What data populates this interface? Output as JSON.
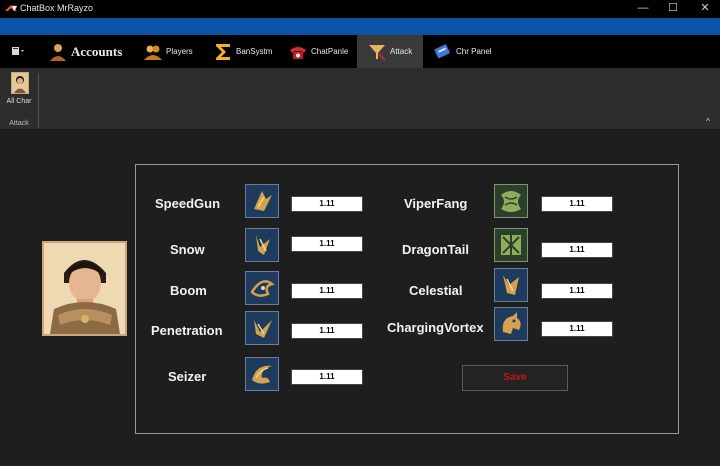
{
  "window": {
    "title": "ChatBox MrRayzo",
    "minimize": "—",
    "maximize": "☐",
    "close": "✕"
  },
  "quick_access": {
    "arrow": "▼"
  },
  "tabs": [
    {
      "label": "Accounts",
      "icon": "accounts-icon",
      "active": false
    },
    {
      "label": "Players",
      "icon": "players-icon",
      "active": false
    },
    {
      "label": "BanSystm",
      "icon": "sigma-icon",
      "active": false
    },
    {
      "label": "ChatPanle",
      "icon": "phone-icon",
      "active": false
    },
    {
      "label": "Attack",
      "icon": "attack-icon",
      "active": true
    },
    {
      "label": "Chr Panel",
      "icon": "chr-panel-icon",
      "active": false
    }
  ],
  "ribbon": {
    "all_char_label": "All Char",
    "group_label": "Attack",
    "collapse": "^"
  },
  "skills_left": [
    {
      "name": "SpeedGun",
      "value": "1.11",
      "icon": "speedgun-icon"
    },
    {
      "name": "Snow",
      "value": "1.11",
      "icon": "snow-icon"
    },
    {
      "name": "Boom",
      "value": "1.11",
      "icon": "boom-icon"
    },
    {
      "name": "Penetration",
      "value": "1.11",
      "icon": "penetration-icon"
    },
    {
      "name": "Seizer",
      "value": "1.11",
      "icon": "seizer-icon"
    }
  ],
  "skills_right": [
    {
      "name": "ViperFang",
      "value": "1.11",
      "icon": "viperfang-icon"
    },
    {
      "name": "DragonTail",
      "value": "1.11",
      "icon": "dragontail-icon"
    },
    {
      "name": "Celestial",
      "value": "1.11",
      "icon": "celestial-icon"
    },
    {
      "name": "ChargingVortex",
      "value": "1.11",
      "icon": "chargingvortex-icon"
    }
  ],
  "save_label": "Save",
  "colors": {
    "title_bar": "#000000",
    "quick_bar": "#0a55a5",
    "workspace": "#1e1e1e",
    "save_text": "#c0141c"
  }
}
